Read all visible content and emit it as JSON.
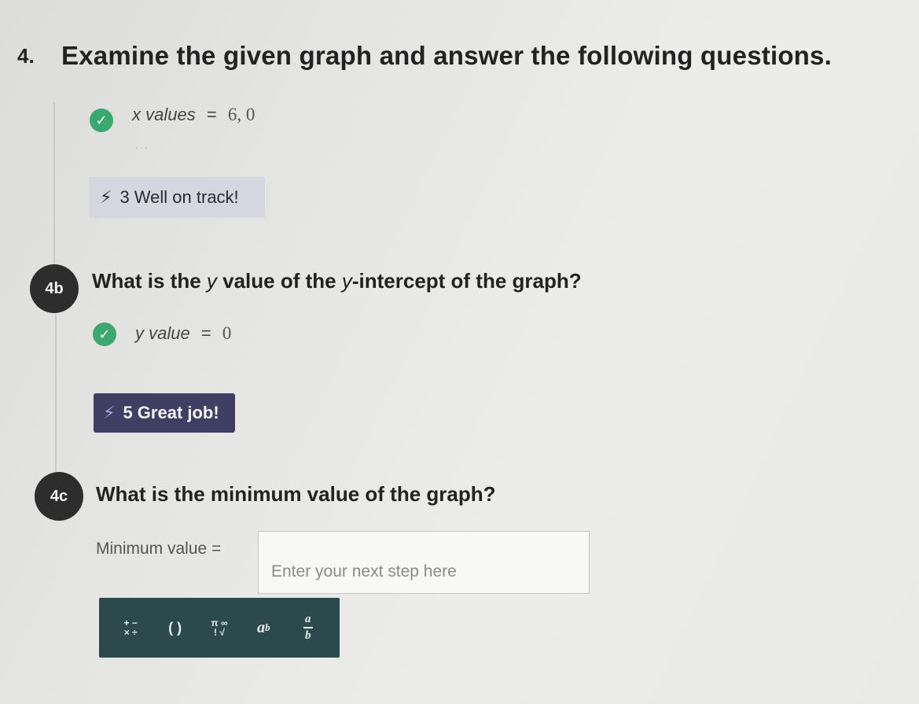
{
  "question": {
    "number": "4.",
    "title": "Examine the given graph and answer the following questions."
  },
  "part_a": {
    "answer_label": "x values",
    "answer_equals": "=",
    "answer_value": "6, 0",
    "dots": "...",
    "badge_text": "3 Well on track!"
  },
  "part_b": {
    "tag": "4b",
    "question_prefix": "What is the",
    "question_var": "y",
    "question_mid": "value of the",
    "question_var2": "y",
    "question_suffix": "-intercept of the graph?",
    "answer_label": "y value",
    "answer_equals": "=",
    "answer_value": "0",
    "badge_text": "5 Great job!"
  },
  "part_c": {
    "tag": "4c",
    "question": "What is the minimum value of the graph?",
    "input_label": "Minimum value =",
    "input_placeholder": "Enter your next step here"
  },
  "toolbar": {
    "tools": [
      {
        "name": "operators-icon",
        "glyph_top": "+ −",
        "glyph_bottom": "× ÷"
      },
      {
        "name": "parentheses-icon",
        "glyph": "( )"
      },
      {
        "name": "pi-infinity-root-icon",
        "glyph_top": "π ∞",
        "glyph_bottom": "! √"
      },
      {
        "name": "exponent-icon",
        "base": "a",
        "exp": "b"
      },
      {
        "name": "fraction-icon",
        "num": "a",
        "den": "b"
      }
    ]
  },
  "colors": {
    "check": "#3aa86f",
    "dark_badge": "#3f3f63",
    "light_badge": "#d6d6de",
    "toolbar": "#2c4a4e"
  }
}
